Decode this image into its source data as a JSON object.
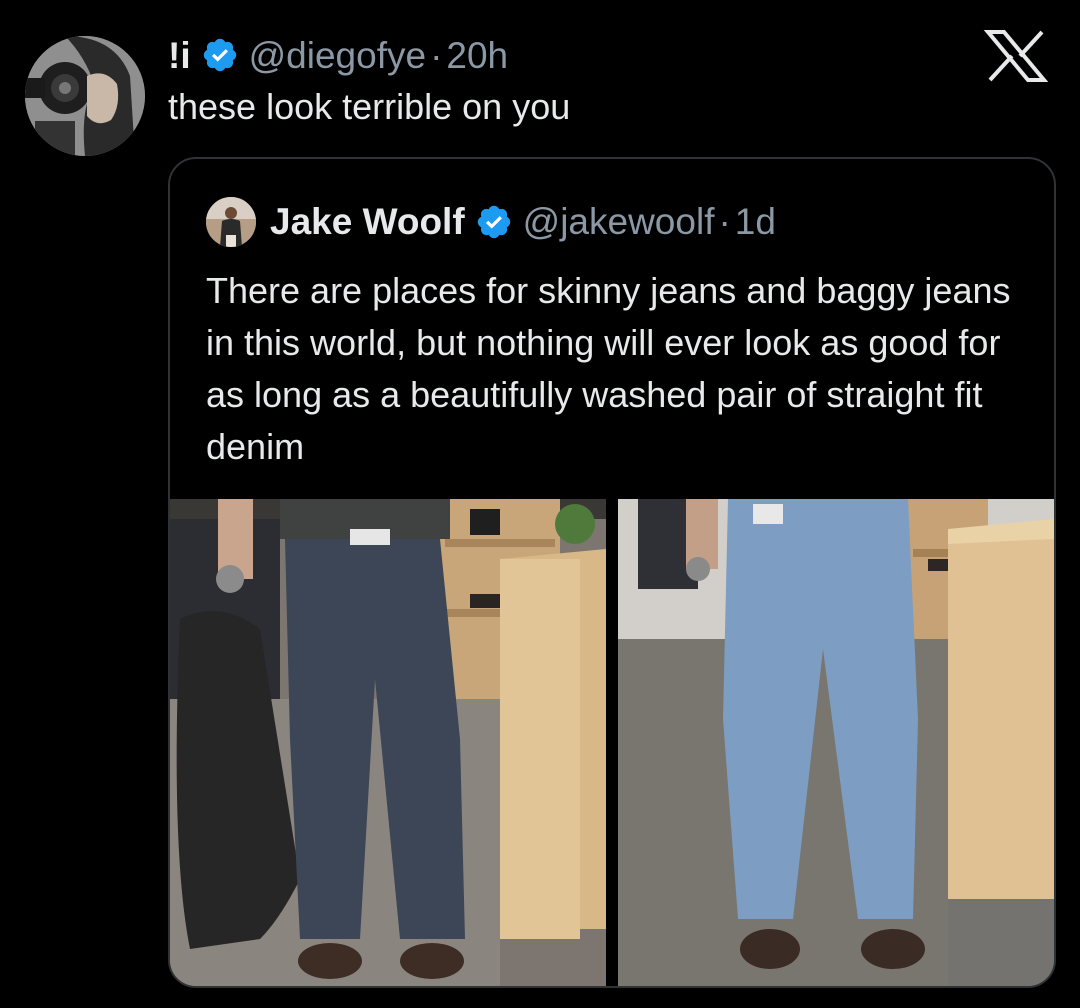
{
  "tweet": {
    "display_name": "!i",
    "handle": "@diegofye",
    "separator": "·",
    "time": "20h",
    "text": "these look terrible on you",
    "avatar_icon": "profile-avatar-camera",
    "verified_icon": "verified-badge-icon"
  },
  "close": {
    "icon": "x-logo-icon"
  },
  "quoted_tweet": {
    "display_name": "Jake Woolf",
    "handle": "@jakewoolf",
    "separator": "·",
    "time": "1d",
    "text": "There are places for skinny jeans and baggy jeans in this world, but nothing will ever look as good for as long as a beautifully washed pair of straight fit denim",
    "verified_icon": "verified-badge-icon",
    "media": [
      {
        "description_icon": "dark-wash-jeans-photo"
      },
      {
        "description_icon": "light-wash-jeans-photo"
      }
    ]
  },
  "colors": {
    "background": "#000000",
    "text_primary": "#e7e9ea",
    "text_secondary": "#8b98a5",
    "verified_blue": "#1d9bf0",
    "border": "#2f3336"
  }
}
